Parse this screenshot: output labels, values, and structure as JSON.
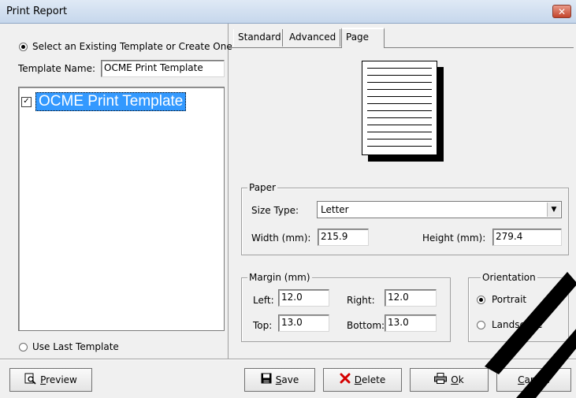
{
  "window": {
    "title": "Print Report",
    "close_symbol": "✕"
  },
  "left": {
    "select_template_label": "Select an Existing Template or Create One",
    "template_name_label": "Template Name:",
    "template_name_value": "OCME Print Template",
    "templates": [
      {
        "label": "OCME Print Template",
        "checked": true
      }
    ],
    "use_last_label": "Use Last Template"
  },
  "tabs": [
    {
      "label": "Standard"
    },
    {
      "label": "Advanced"
    },
    {
      "label": "Page"
    }
  ],
  "paper": {
    "legend": "Paper",
    "size_type_label": "Size Type:",
    "size_type_value": "Letter",
    "width_label": "Width (mm):",
    "width_value": "215.9",
    "height_label": "Height (mm):",
    "height_value": "279.4"
  },
  "margin": {
    "legend": "Margin (mm)",
    "left_label": "Left:",
    "left_value": "12.0",
    "right_label": "Right:",
    "right_value": "12.0",
    "top_label": "Top:",
    "top_value": "13.0",
    "bottom_label": "Bottom:",
    "bottom_value": "13.0"
  },
  "orientation": {
    "legend": "Orientation",
    "portrait_label": "Portrait",
    "landscape_label": "Landscape",
    "selected": "Portrait"
  },
  "buttons": {
    "preview": {
      "accel": "P",
      "rest": "review",
      "icon": "preview-icon"
    },
    "save": {
      "accel": "S",
      "rest": "ave",
      "icon": "floppy-icon"
    },
    "delete": {
      "accel": "D",
      "rest": "elete",
      "icon": "red-x-icon"
    },
    "ok": {
      "accel": "O",
      "rest": "k",
      "icon": "printer-icon"
    },
    "cancel": {
      "accel": "C",
      "rest": "ancel"
    }
  },
  "colors": {
    "selection": "#3399ff",
    "delete_x": "#d40000",
    "watermark": "#000000"
  }
}
